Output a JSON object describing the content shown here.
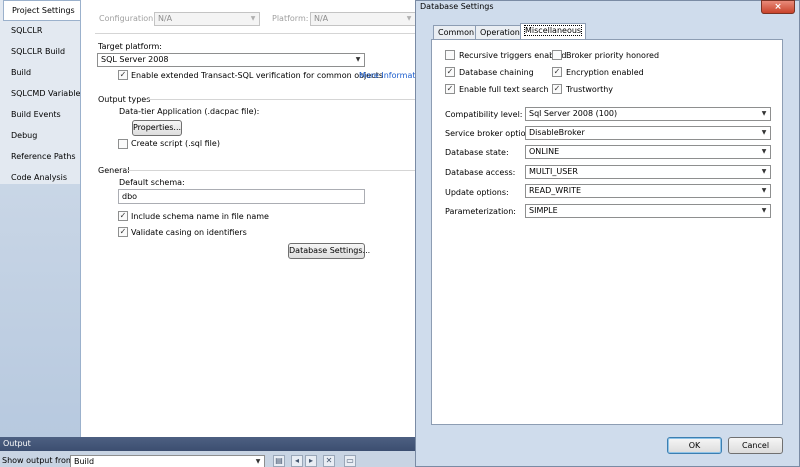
{
  "sidebar": {
    "items": [
      {
        "label": "Project Settings",
        "active": true
      },
      {
        "label": "SQLCLR"
      },
      {
        "label": "SQLCLR Build"
      },
      {
        "label": "Build"
      },
      {
        "label": "SQLCMD Variables"
      },
      {
        "label": "Build Events"
      },
      {
        "label": "Debug"
      },
      {
        "label": "Reference Paths"
      },
      {
        "label": "Code Analysis"
      }
    ]
  },
  "project": {
    "configuration_label": "Configuration:",
    "configuration_value": "N/A",
    "platform_label": "Platform:",
    "platform_value": "N/A",
    "target_platform_label": "Target platform:",
    "target_platform_value": "SQL Server 2008",
    "enable_tsql_label": "Enable extended Transact-SQL verification for common objects",
    "enable_tsql_checked": true,
    "more_info_link": "More Informatio",
    "output_types_label": "Output types",
    "data_tier_label": "Data-tier Application (.dacpac file):",
    "properties_button": "Properties...",
    "create_script_label": "Create script (.sql file)",
    "create_script_checked": false,
    "general_label": "General",
    "default_schema_label": "Default schema:",
    "default_schema_value": "dbo",
    "include_schema_label": "Include schema name in file name",
    "include_schema_checked": true,
    "validate_casing_label": "Validate casing on identifiers",
    "validate_casing_checked": true,
    "database_settings_button": "Database Settings..."
  },
  "output": {
    "title": "Output",
    "show_output_label": "Show output from:",
    "show_output_value": "Build"
  },
  "dialog": {
    "title": "Database Settings",
    "close_glyph": "×",
    "tabs": [
      {
        "label": "Common"
      },
      {
        "label": "Operational"
      },
      {
        "label": "Miscellaneous",
        "active": true
      }
    ],
    "checks": {
      "recursive_triggers": {
        "label": "Recursive triggers enabled",
        "checked": false
      },
      "broker_priority": {
        "label": "Broker priority honored",
        "checked": false
      },
      "database_chaining": {
        "label": "Database chaining",
        "checked": true
      },
      "encryption": {
        "label": "Encryption enabled",
        "checked": true
      },
      "full_text_search": {
        "label": "Enable full text search",
        "checked": true
      },
      "trustworthy": {
        "label": "Trustworthy",
        "checked": true
      }
    },
    "fields": {
      "compatibility": {
        "label": "Compatibility level:",
        "value": "Sql Server 2008 (100)"
      },
      "service_broker": {
        "label": "Service broker options:",
        "value": "DisableBroker"
      },
      "database_state": {
        "label": "Database state:",
        "value": "ONLINE"
      },
      "database_access": {
        "label": "Database access:",
        "value": "MULTI_USER"
      },
      "update_options": {
        "label": "Update options:",
        "value": "READ_WRITE"
      },
      "parameterization": {
        "label": "Parameterization:",
        "value": "SIMPLE"
      }
    },
    "ok_button": "OK",
    "cancel_button": "Cancel"
  },
  "icons": {
    "dropdown_arrow": "▼",
    "check_mark": "✓"
  }
}
